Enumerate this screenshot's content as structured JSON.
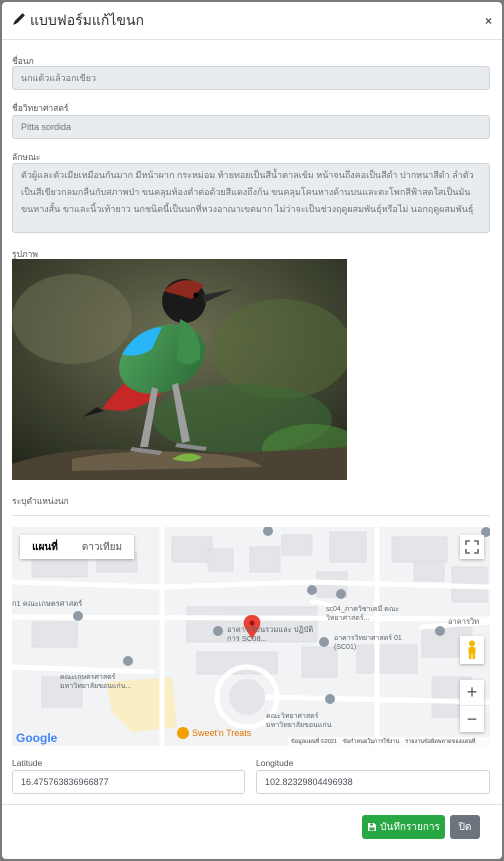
{
  "modal": {
    "title": "แบบฟอร์มแก้ไขนก",
    "close": "×"
  },
  "fields": {
    "name_label": "ชื่อนก",
    "name_value": "นกแต้วแล้วอกเขียว",
    "sci_label": "ชื่อวิทยาศาสตร์",
    "sci_value": "Pitta sordida",
    "desc_label": "ลักษณะ",
    "desc_value": "ตัวผู้และตัวเมียเหมือนกันมาก มีหน้าผาก กระหม่อม ท้ายทอยเป็นสีน้ำตาลเข้ม หน้าจนถึงคอเป็นสีดำ ปากหนาสีดำ ลำตัวเป็นสีเขียวกลมกลืนกับสภาพป่า ขนคลุมท้องตำต่อด้วยสีแดงถึงก้น ขนคลุมโคนหางด้านบนและตะโพกสีฟ้าสดใสเป็นมัน ขนหางสั้น ขาและนิ้วเท้ายาว นกชนิดนี้เป็นนกที่หวงอาณาเขตมาก ไม่ว่าจะเป็นช่วงฤดูผสมพันธุ์หรือไม่ นอกฤดูผสมพันธุ์",
    "image_label": "รูปภาพ",
    "location_label": "ระบุตำแหน่งนก",
    "lat_label": "Latitude",
    "lat_value": "16.475763836966877",
    "lng_label": "Longitude",
    "lng_value": "102.82329804496938"
  },
  "map": {
    "tab_map": "แผนที่",
    "tab_satellite": "ดาวเทียม",
    "zoom_in": "+",
    "zoom_out": "−",
    "google": "Google",
    "footer_data": "ข้อมูลแผนที่ ©2021",
    "footer_terms": "ข้อกำหนดในการใช้งาน",
    "footer_report": "รายงานข้อผิดพลาดของแผนที่",
    "places": {
      "p1": "ก1 คณะเกษตรศาสตร์",
      "p2": "sc04_ภาควิชาเคมี คณะวิทยาศาสตร์...",
      "p3": "อาคารวิท",
      "p4": "อาคารวิทยาศาสตร์ 01 (SC01)",
      "p5": "อาคารเรียนรวมและ ปฏิบัติการ SC08...",
      "p6": "คณะเกษตรศาสตร์ มหาวิทยาลัยขอนแก่น...",
      "p7": "คณะวิทยาศาสตร์ มหาวิทยาลัยขอนแก่น",
      "p8": "Sweet'n Treats"
    }
  },
  "buttons": {
    "save": "บันทึกรายการ",
    "close": "ปิด"
  },
  "colors": {
    "save_bg": "#28a745",
    "close_bg": "#6c757d",
    "pin": "#ea4335"
  }
}
